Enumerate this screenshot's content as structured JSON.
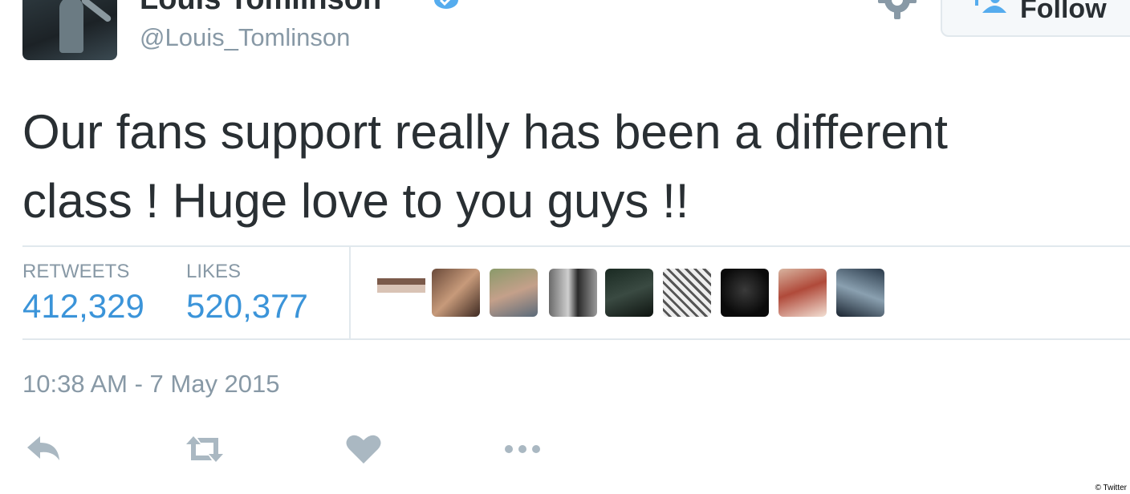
{
  "user": {
    "name": "Louis Tomlinson",
    "handle": "@Louis_Tomlinson"
  },
  "follow_button": {
    "label": "Follow"
  },
  "tweet": {
    "line1": "Our fans support really has been a different",
    "line2": "class ! Huge love to you guys !!"
  },
  "stats": {
    "retweets_label": "RETWEETS",
    "retweets_value": "412,329",
    "likes_label": "LIKES",
    "likes_value": "520,377"
  },
  "timestamp": "10:38 AM - 7 May 2015",
  "actions": [
    "reply-icon",
    "retweet-icon",
    "heart-icon",
    "more-icon"
  ],
  "credit": "© Twitter",
  "colors": {
    "text": "#292f33",
    "secondary": "#8899a6",
    "accent": "#3b94d9",
    "action_icon": "#aab8c2",
    "divider": "#e1e8ed"
  }
}
